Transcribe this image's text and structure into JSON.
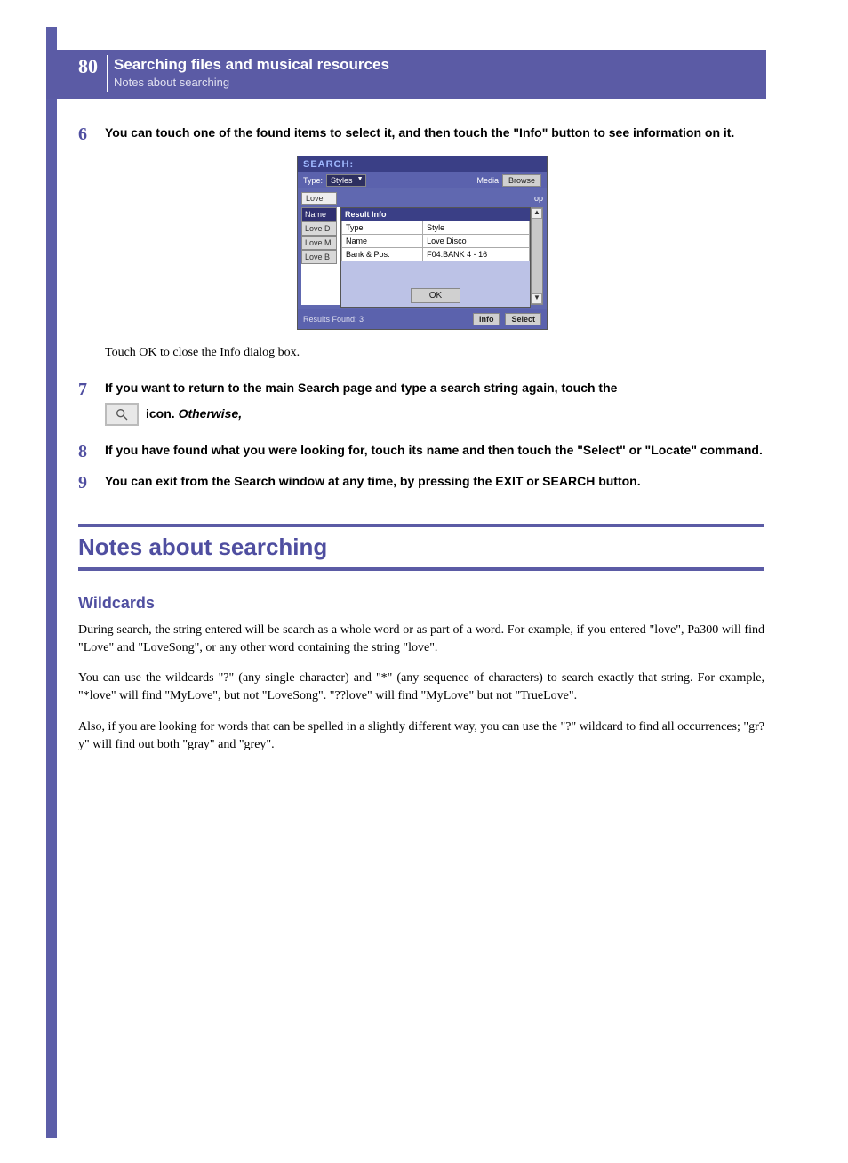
{
  "header": {
    "page_number": "80",
    "chapter_title": "Searching files and musical resources",
    "sub_title": "Notes about searching"
  },
  "steps": {
    "s6": {
      "num": "6",
      "text": "You can touch one of the found items to select it, and then touch the \"Info\" button to see information on it."
    },
    "s6_caption": "Touch OK to close the Info dialog box.",
    "s7": {
      "num": "7",
      "text_a": "If you want to return to the main Search page and type a search string again, touch the",
      "text_b": "icon.",
      "text_c": "Otherwise,"
    },
    "s8": {
      "num": "8",
      "text": "If you have found what you were looking for, touch its name and then touch the \"Select\" or \"Locate\" command."
    },
    "s9": {
      "num": "9",
      "text": "You can exit from the Search window at any time, by pressing the EXIT or SEARCH button."
    }
  },
  "screenshot": {
    "title": "SEARCH:",
    "type_label": "Type:",
    "type_value": "Styles",
    "media_label": "Media",
    "browse_btn": "Browse",
    "search_value": "Love",
    "op_suffix": "op",
    "name_tab": "Name",
    "left_items": [
      "Love D",
      "Love M",
      "Love B"
    ],
    "dialog_title": "Result Info",
    "table": {
      "r1": [
        "Type",
        "Style"
      ],
      "r2": [
        "Name",
        "Love Disco"
      ],
      "r3": [
        "Bank & Pos.",
        "F04:BANK 4 - 16"
      ]
    },
    "ok": "OK",
    "results_found": "Results Found: 3",
    "info_btn": "Info",
    "select_btn": "Select"
  },
  "section": {
    "heading": "Notes about searching",
    "sub_heading": "Wildcards",
    "p1": "During search, the string entered will be search as a whole word or as part of a word. For example, if you entered \"love\", Pa300 will find \"Love\" and \"LoveSong\", or any other word containing the string \"love\".",
    "p2": "You can use the wildcards \"?\" (any single character) and \"*\" (any sequence of characters) to search exactly that string. For example, \"*love\" will find \"MyLove\", but not \"LoveSong\". \"??love\" will find \"MyLove\" but not \"TrueLove\".",
    "p3": "Also, if you are looking for words that can be spelled in a slightly different way, you can use the \"?\" wildcard to find all occurrences; \"gr?y\" will find out both \"gray\" and \"grey\"."
  }
}
